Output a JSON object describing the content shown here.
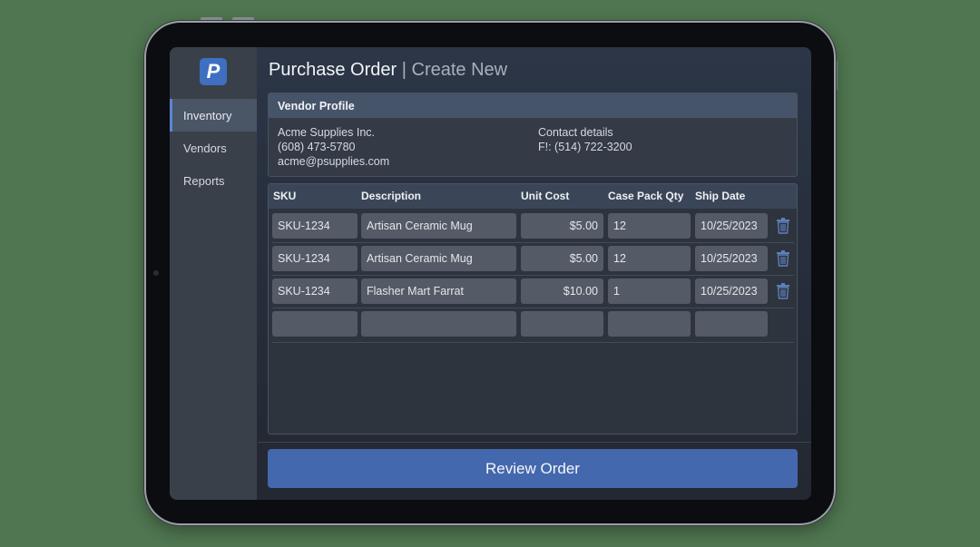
{
  "app": {
    "logo_letter": "P",
    "accent_color": "#3f6fc0"
  },
  "sidebar": {
    "items": [
      {
        "label": "Inventory",
        "active": true
      },
      {
        "label": "Vendors",
        "active": false
      },
      {
        "label": "Reports",
        "active": false
      }
    ]
  },
  "header": {
    "title": "Purchase Order",
    "separator": "|",
    "subtitle": "Create New"
  },
  "vendor": {
    "section_title": "Vendor Profile",
    "name": "Acme Supplies Inc.",
    "phone": "(608) 473-5780",
    "email": "acme@psupplies.com",
    "contact_label": "Contact details",
    "contact_value": "F!: (514) 722-3200"
  },
  "table": {
    "columns": [
      "SKU",
      "Description",
      "Unit Cost",
      "Case Pack Qty",
      "Ship Date"
    ],
    "rows": [
      {
        "sku": "SKU-1234",
        "description": "Artisan Ceramic Mug",
        "unit_cost": "$5.00",
        "case_pack_qty": "12",
        "ship_date": "10/25/2023"
      },
      {
        "sku": "SKU-1234",
        "description": "Artisan Ceramic Mug",
        "unit_cost": "$5.00",
        "case_pack_qty": "12",
        "ship_date": "10/25/2023"
      },
      {
        "sku": "SKU-1234",
        "description": "Flasher Mart Farrat",
        "unit_cost": "$10.00",
        "case_pack_qty": "1",
        "ship_date": "10/25/2023"
      },
      {
        "sku": "",
        "description": "",
        "unit_cost": "",
        "case_pack_qty": "",
        "ship_date": ""
      }
    ],
    "delete_icon": "trash-icon"
  },
  "actions": {
    "review_label": "Review Order"
  }
}
